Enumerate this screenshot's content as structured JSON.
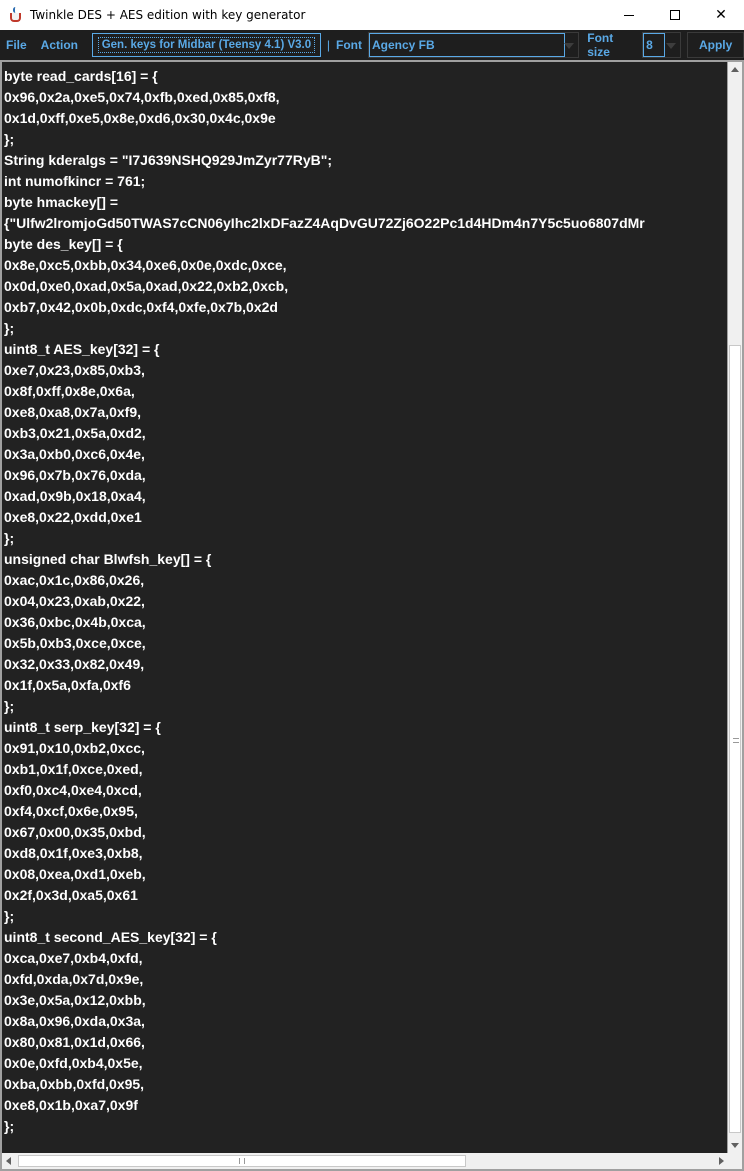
{
  "window": {
    "title": "Twinkle DES + AES edition with key generator",
    "minimize_glyph": "",
    "maximize_glyph": "",
    "close_glyph": "✕"
  },
  "toolbar": {
    "menu_file": "File",
    "menu_action": "Action",
    "keygen_label": "Gen. keys for Midbar (Teensy 4.1) V3.0",
    "separator1": "|",
    "font_label": "Font",
    "font_value": "Agency FB",
    "font_size_label": "Font size",
    "font_size_value": "8",
    "apply_label": "Apply"
  },
  "colors": {
    "toolbar_bg": "#1e1e1e",
    "accent": "#5aa9e6",
    "editor_bg": "#222222",
    "editor_text": "#ffffff"
  },
  "icons": {
    "app": "java-cup-icon",
    "combo_arrow": "chevron-down-icon"
  },
  "editor": {
    "lines": [
      "byte read_cards[16] = {",
      "0x96,0x2a,0xe5,0x74,0xfb,0xed,0x85,0xf8,",
      "0x1d,0xff,0xe5,0x8e,0xd6,0x30,0x4c,0x9e",
      "};",
      "String kderalgs = \"I7J639NSHQ929JmZyr77RyB\";",
      "int numofkincr = 761;",
      "byte hmackey[] =",
      "{\"Ulfw2lromjoGd50TWAS7cCN06yIhc2lxDFazZ4AqDvGU72Zj6O22Pc1d4HDm4n7Y5c5uo6807dMr",
      "byte des_key[] = {",
      "0x8e,0xc5,0xbb,0x34,0xe6,0x0e,0xdc,0xce,",
      "0x0d,0xe0,0xad,0x5a,0xad,0x22,0xb2,0xcb,",
      "0xb7,0x42,0x0b,0xdc,0xf4,0xfe,0x7b,0x2d",
      "};",
      "uint8_t AES_key[32] = {",
      "0xe7,0x23,0x85,0xb3,",
      "0x8f,0xff,0x8e,0x6a,",
      "0xe8,0xa8,0x7a,0xf9,",
      "0xb3,0x21,0x5a,0xd2,",
      "0x3a,0xb0,0xc6,0x4e,",
      "0x96,0x7b,0x76,0xda,",
      "0xad,0x9b,0x18,0xa4,",
      "0xe8,0x22,0xdd,0xe1",
      "};",
      "unsigned char Blwfsh_key[] = {",
      "0xac,0x1c,0x86,0x26,",
      "0x04,0x23,0xab,0x22,",
      "0x36,0xbc,0x4b,0xca,",
      "0x5b,0xb3,0xce,0xce,",
      "0x32,0x33,0x82,0x49,",
      "0x1f,0x5a,0xfa,0xf6",
      "};",
      "uint8_t serp_key[32] = {",
      "0x91,0x10,0xb2,0xcc,",
      "0xb1,0x1f,0xce,0xed,",
      "0xf0,0xc4,0xe4,0xcd,",
      "0xf4,0xcf,0x6e,0x95,",
      "0x67,0x00,0x35,0xbd,",
      "0xd8,0x1f,0xe3,0xb8,",
      "0x08,0xea,0xd1,0xeb,",
      "0x2f,0x3d,0xa5,0x61",
      "};",
      "uint8_t second_AES_key[32] = {",
      "0xca,0xe7,0xb4,0xfd,",
      "0xfd,0xda,0x7d,0x9e,",
      "0x3e,0x5a,0x12,0xbb,",
      "0x8a,0x96,0xda,0x3a,",
      "0x80,0x81,0x1d,0x66,",
      "0x0e,0xfd,0xb4,0x5e,",
      "0xba,0xbb,0xfd,0x95,",
      "0xe8,0x1b,0xa7,0x9f",
      "};"
    ]
  }
}
